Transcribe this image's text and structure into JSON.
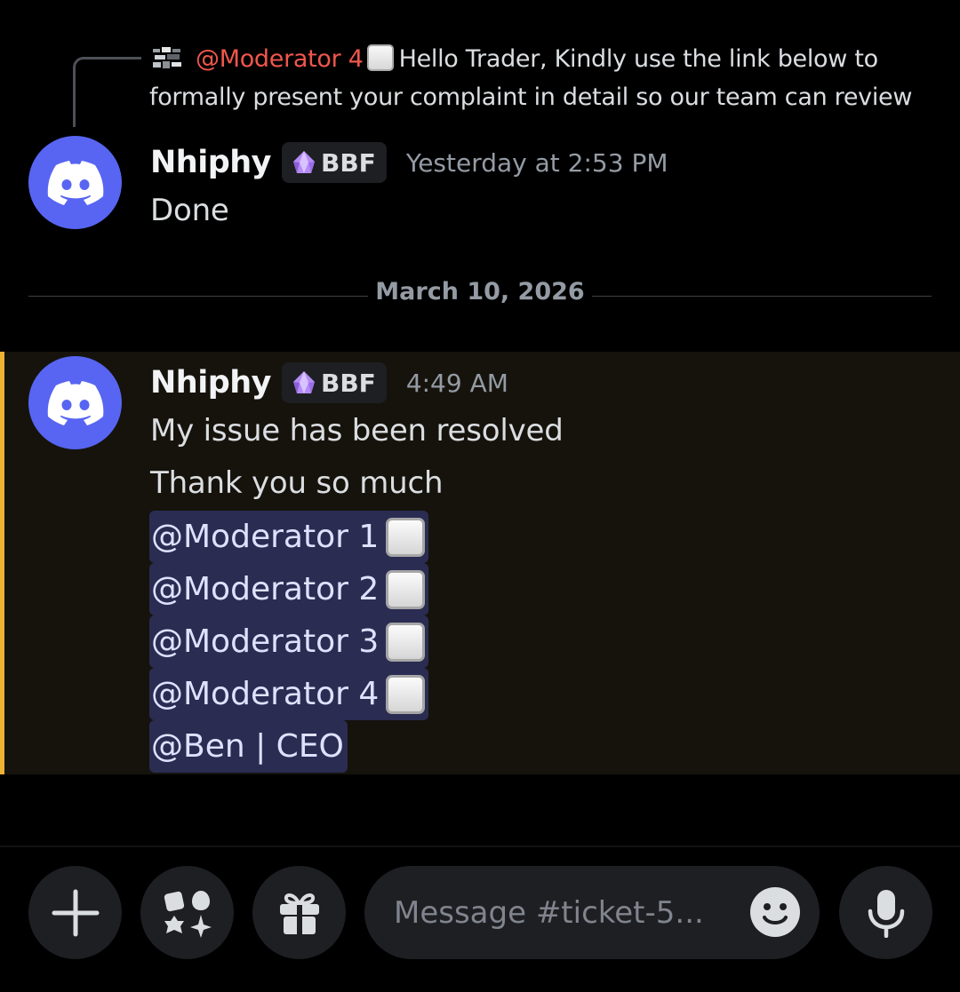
{
  "reply": {
    "mention": "@Moderator 4",
    "text_first": "Hello Trader,  Kindly use the link below to",
    "text_second": "formally present your complaint in detail so our team can review"
  },
  "messages": [
    {
      "author": "Nhiphy",
      "tag": "BBF",
      "timestamp": "Yesterday at 2:53 PM",
      "lines": [
        "Done"
      ]
    },
    {
      "author": "Nhiphy",
      "tag": "BBF",
      "timestamp": "4:49 AM",
      "lines": [
        "My issue has been resolved",
        "Thank you so much"
      ],
      "mentions": [
        "@Moderator 1",
        "@Moderator 2",
        "@Moderator 3",
        "@Moderator 4",
        "@Ben | CEO"
      ]
    }
  ],
  "divider": {
    "date": "March 10, 2026"
  },
  "composer": {
    "placeholder": "Message #ticket-5..."
  },
  "icons": {
    "avatar": "discord-logo-icon",
    "tag": "crystal-gem-icon",
    "mention_suffix": "white-square-emoji-icon",
    "add": "plus-icon",
    "apps": "apps-shapes-icon",
    "gift": "gift-icon",
    "emoji": "smiley-emoji-icon",
    "voice": "microphone-icon"
  },
  "colors": {
    "background": "#000000",
    "avatar_blurple": "#5865f2",
    "reply_mention": "#f0574c",
    "mention_highlight_bar": "#f0b232",
    "mention_pill_bg": "#2a2c52",
    "mention_pill_text": "#dfe1ff"
  }
}
